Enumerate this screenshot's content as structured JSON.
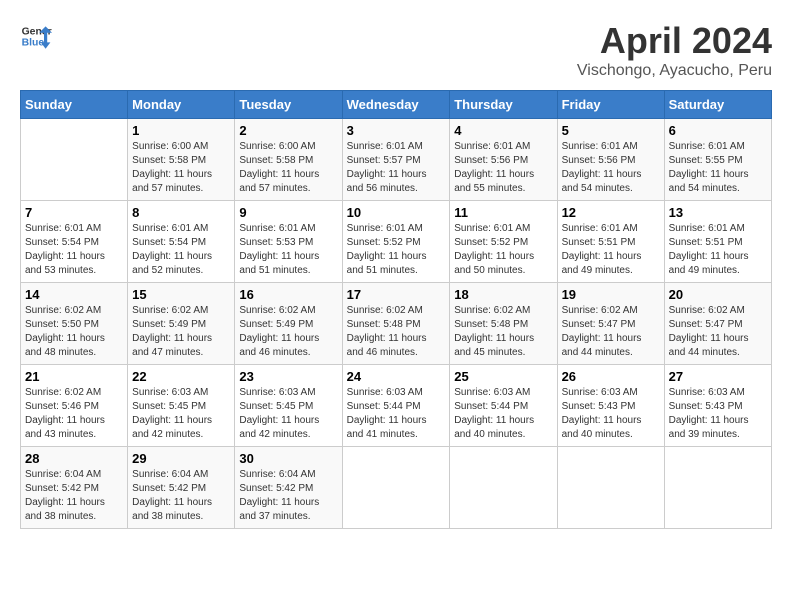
{
  "header": {
    "logo_line1": "General",
    "logo_line2": "Blue",
    "month_title": "April 2024",
    "location": "Vischongo, Ayacucho, Peru"
  },
  "weekdays": [
    "Sunday",
    "Monday",
    "Tuesday",
    "Wednesday",
    "Thursday",
    "Friday",
    "Saturday"
  ],
  "weeks": [
    [
      {
        "day": "",
        "sunrise": "",
        "sunset": "",
        "daylight": ""
      },
      {
        "day": "1",
        "sunrise": "Sunrise: 6:00 AM",
        "sunset": "Sunset: 5:58 PM",
        "daylight": "Daylight: 11 hours and 57 minutes."
      },
      {
        "day": "2",
        "sunrise": "Sunrise: 6:00 AM",
        "sunset": "Sunset: 5:58 PM",
        "daylight": "Daylight: 11 hours and 57 minutes."
      },
      {
        "day": "3",
        "sunrise": "Sunrise: 6:01 AM",
        "sunset": "Sunset: 5:57 PM",
        "daylight": "Daylight: 11 hours and 56 minutes."
      },
      {
        "day": "4",
        "sunrise": "Sunrise: 6:01 AM",
        "sunset": "Sunset: 5:56 PM",
        "daylight": "Daylight: 11 hours and 55 minutes."
      },
      {
        "day": "5",
        "sunrise": "Sunrise: 6:01 AM",
        "sunset": "Sunset: 5:56 PM",
        "daylight": "Daylight: 11 hours and 54 minutes."
      },
      {
        "day": "6",
        "sunrise": "Sunrise: 6:01 AM",
        "sunset": "Sunset: 5:55 PM",
        "daylight": "Daylight: 11 hours and 54 minutes."
      }
    ],
    [
      {
        "day": "7",
        "sunrise": "Sunrise: 6:01 AM",
        "sunset": "Sunset: 5:54 PM",
        "daylight": "Daylight: 11 hours and 53 minutes."
      },
      {
        "day": "8",
        "sunrise": "Sunrise: 6:01 AM",
        "sunset": "Sunset: 5:54 PM",
        "daylight": "Daylight: 11 hours and 52 minutes."
      },
      {
        "day": "9",
        "sunrise": "Sunrise: 6:01 AM",
        "sunset": "Sunset: 5:53 PM",
        "daylight": "Daylight: 11 hours and 51 minutes."
      },
      {
        "day": "10",
        "sunrise": "Sunrise: 6:01 AM",
        "sunset": "Sunset: 5:52 PM",
        "daylight": "Daylight: 11 hours and 51 minutes."
      },
      {
        "day": "11",
        "sunrise": "Sunrise: 6:01 AM",
        "sunset": "Sunset: 5:52 PM",
        "daylight": "Daylight: 11 hours and 50 minutes."
      },
      {
        "day": "12",
        "sunrise": "Sunrise: 6:01 AM",
        "sunset": "Sunset: 5:51 PM",
        "daylight": "Daylight: 11 hours and 49 minutes."
      },
      {
        "day": "13",
        "sunrise": "Sunrise: 6:01 AM",
        "sunset": "Sunset: 5:51 PM",
        "daylight": "Daylight: 11 hours and 49 minutes."
      }
    ],
    [
      {
        "day": "14",
        "sunrise": "Sunrise: 6:02 AM",
        "sunset": "Sunset: 5:50 PM",
        "daylight": "Daylight: 11 hours and 48 minutes."
      },
      {
        "day": "15",
        "sunrise": "Sunrise: 6:02 AM",
        "sunset": "Sunset: 5:49 PM",
        "daylight": "Daylight: 11 hours and 47 minutes."
      },
      {
        "day": "16",
        "sunrise": "Sunrise: 6:02 AM",
        "sunset": "Sunset: 5:49 PM",
        "daylight": "Daylight: 11 hours and 46 minutes."
      },
      {
        "day": "17",
        "sunrise": "Sunrise: 6:02 AM",
        "sunset": "Sunset: 5:48 PM",
        "daylight": "Daylight: 11 hours and 46 minutes."
      },
      {
        "day": "18",
        "sunrise": "Sunrise: 6:02 AM",
        "sunset": "Sunset: 5:48 PM",
        "daylight": "Daylight: 11 hours and 45 minutes."
      },
      {
        "day": "19",
        "sunrise": "Sunrise: 6:02 AM",
        "sunset": "Sunset: 5:47 PM",
        "daylight": "Daylight: 11 hours and 44 minutes."
      },
      {
        "day": "20",
        "sunrise": "Sunrise: 6:02 AM",
        "sunset": "Sunset: 5:47 PM",
        "daylight": "Daylight: 11 hours and 44 minutes."
      }
    ],
    [
      {
        "day": "21",
        "sunrise": "Sunrise: 6:02 AM",
        "sunset": "Sunset: 5:46 PM",
        "daylight": "Daylight: 11 hours and 43 minutes."
      },
      {
        "day": "22",
        "sunrise": "Sunrise: 6:03 AM",
        "sunset": "Sunset: 5:45 PM",
        "daylight": "Daylight: 11 hours and 42 minutes."
      },
      {
        "day": "23",
        "sunrise": "Sunrise: 6:03 AM",
        "sunset": "Sunset: 5:45 PM",
        "daylight": "Daylight: 11 hours and 42 minutes."
      },
      {
        "day": "24",
        "sunrise": "Sunrise: 6:03 AM",
        "sunset": "Sunset: 5:44 PM",
        "daylight": "Daylight: 11 hours and 41 minutes."
      },
      {
        "day": "25",
        "sunrise": "Sunrise: 6:03 AM",
        "sunset": "Sunset: 5:44 PM",
        "daylight": "Daylight: 11 hours and 40 minutes."
      },
      {
        "day": "26",
        "sunrise": "Sunrise: 6:03 AM",
        "sunset": "Sunset: 5:43 PM",
        "daylight": "Daylight: 11 hours and 40 minutes."
      },
      {
        "day": "27",
        "sunrise": "Sunrise: 6:03 AM",
        "sunset": "Sunset: 5:43 PM",
        "daylight": "Daylight: 11 hours and 39 minutes."
      }
    ],
    [
      {
        "day": "28",
        "sunrise": "Sunrise: 6:04 AM",
        "sunset": "Sunset: 5:42 PM",
        "daylight": "Daylight: 11 hours and 38 minutes."
      },
      {
        "day": "29",
        "sunrise": "Sunrise: 6:04 AM",
        "sunset": "Sunset: 5:42 PM",
        "daylight": "Daylight: 11 hours and 38 minutes."
      },
      {
        "day": "30",
        "sunrise": "Sunrise: 6:04 AM",
        "sunset": "Sunset: 5:42 PM",
        "daylight": "Daylight: 11 hours and 37 minutes."
      },
      {
        "day": "",
        "sunrise": "",
        "sunset": "",
        "daylight": ""
      },
      {
        "day": "",
        "sunrise": "",
        "sunset": "",
        "daylight": ""
      },
      {
        "day": "",
        "sunrise": "",
        "sunset": "",
        "daylight": ""
      },
      {
        "day": "",
        "sunrise": "",
        "sunset": "",
        "daylight": ""
      }
    ]
  ]
}
